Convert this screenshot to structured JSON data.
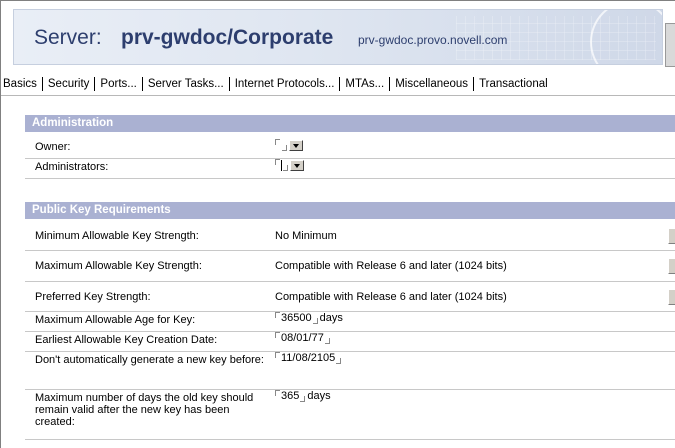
{
  "header": {
    "title_prefix": "Server:",
    "server_name": "prv-gwdoc/Corporate",
    "host": "prv-gwdoc.provo.novell.com"
  },
  "tabs": [
    {
      "label": "Basics"
    },
    {
      "label": "Security"
    },
    {
      "label": "Ports..."
    },
    {
      "label": "Server Tasks..."
    },
    {
      "label": "Internet Protocols..."
    },
    {
      "label": "MTAs..."
    },
    {
      "label": "Miscellaneous"
    },
    {
      "label": "Transactional"
    }
  ],
  "administration": {
    "heading": "Administration",
    "owner_label": "Owner:",
    "owner_value": "",
    "administrators_label": "Administrators:",
    "administrators_value": ""
  },
  "public_key": {
    "heading": "Public Key Requirements",
    "min_strength_label": "Minimum Allowable Key Strength:",
    "min_strength_value": "No Minimum",
    "max_strength_label": "Maximum Allowable Key Strength:",
    "max_strength_value": "Compatible with Release 6 and later (1024 bits)",
    "preferred_strength_label": "Preferred Key Strength:",
    "preferred_strength_value": "Compatible with Release 6 and later (1024 bits)",
    "max_age_label": "Maximum Allowable Age for Key:",
    "max_age_value": "36500",
    "max_age_unit": "days",
    "earliest_date_label": "Earliest Allowable Key Creation Date:",
    "earliest_date_value": "08/01/77",
    "no_autogen_label": "Don't automatically generate a new key before:",
    "no_autogen_value": "11/08/2105",
    "old_key_days_label": "Maximum number of days the old key should remain valid after the new key has been created:",
    "old_key_days_value": "365",
    "old_key_days_unit": "days"
  },
  "colors": {
    "title_text": "#2d3e6e",
    "section_header_bg": "#aab1d2",
    "header_banner_bg": "#dfe6f1"
  },
  "icons": {
    "dropdown": "chevron-down-icon",
    "field_bracket": "field-corner-icon"
  }
}
